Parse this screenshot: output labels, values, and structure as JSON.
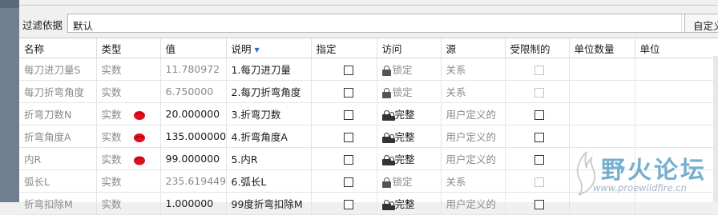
{
  "filter": {
    "label": "过滤依据",
    "value": "默认",
    "custom_label": "自定义"
  },
  "columns": [
    "名称",
    "类型",
    "值",
    "说明",
    "指定",
    "访问",
    "源",
    "受限制的",
    "单位数量",
    "单位"
  ],
  "rows": [
    {
      "name": "每刀进刀量S",
      "type": "实数",
      "value": "11.780972",
      "desc": "1.每刀进刀量",
      "access": "锁定",
      "source": "关系"
    },
    {
      "name": "每刀折弯角度",
      "type": "实数",
      "value": "6.750000",
      "desc": "2.每刀折弯角度",
      "access": "锁定",
      "source": "关系"
    },
    {
      "name": "折弯刀数N",
      "type": "实数",
      "value": "20.000000",
      "desc": "3.折弯刀数",
      "access": "完整",
      "source": "用户定义的"
    },
    {
      "name": "折弯角度A",
      "type": "实数",
      "value": "135.000000",
      "desc": "4.折弯角度A",
      "access": "完整",
      "source": "用户定义的"
    },
    {
      "name": "内R",
      "type": "实数",
      "value": "99.000000",
      "desc": "5.内R",
      "access": "完整",
      "source": "用户定义的"
    },
    {
      "name": "弧长L",
      "type": "实数",
      "value": "235.619449",
      "desc": "6.弧长L",
      "access": "锁定",
      "source": "关系"
    },
    {
      "name": "折弯扣除M",
      "type": "实数",
      "value": "1.000000",
      "desc": "99度折弯扣除M",
      "access": "完整",
      "source": "用户定义的"
    }
  ],
  "watermark": {
    "title": "野火论坛",
    "url": "www.proewildfire.cn"
  }
}
